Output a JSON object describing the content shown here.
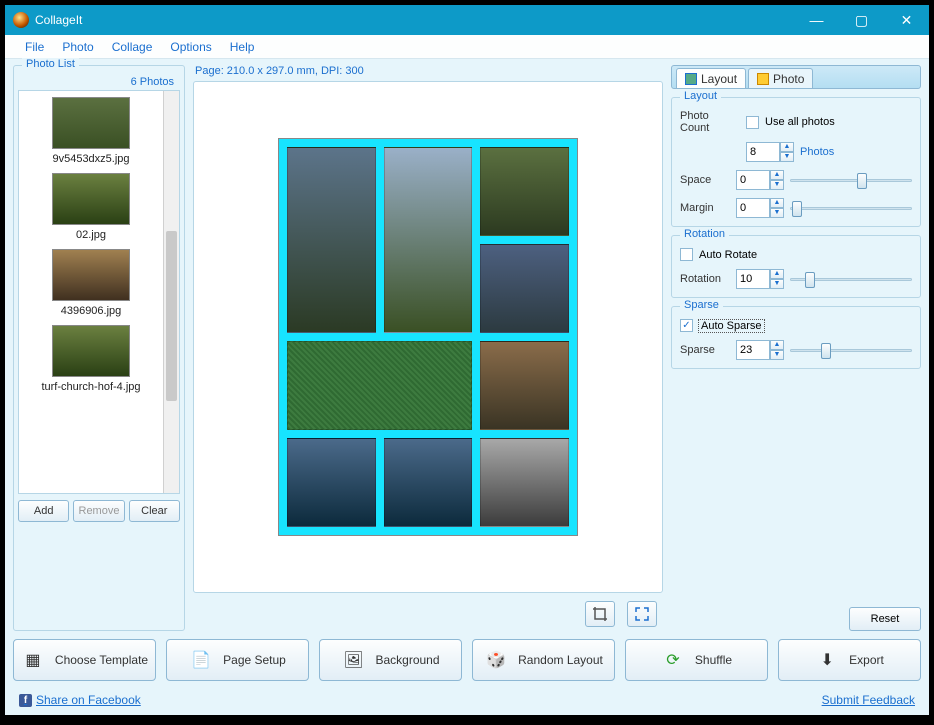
{
  "window": {
    "title": "CollageIt"
  },
  "menu": {
    "items": [
      "File",
      "Photo",
      "Collage",
      "Options",
      "Help"
    ]
  },
  "photoList": {
    "legend": "Photo List",
    "countLabel": "6 Photos",
    "items": [
      {
        "name": "9v5453dxz5.jpg"
      },
      {
        "name": "02.jpg"
      },
      {
        "name": "4396906.jpg"
      },
      {
        "name": "turf-church-hof-4.jpg"
      }
    ],
    "buttons": {
      "add": "Add",
      "remove": "Remove",
      "clear": "Clear"
    }
  },
  "page": {
    "info": "Page: 210.0 x 297.0 mm, DPI: 300"
  },
  "rightTabs": {
    "layout": "Layout",
    "photo": "Photo"
  },
  "layout": {
    "legend": "Layout",
    "photoCountLabel": "Photo Count",
    "useAllPhotos": "Use all photos",
    "photoCountValue": "8",
    "photosSuffix": "Photos",
    "spaceLabel": "Space",
    "spaceValue": "0",
    "marginLabel": "Margin",
    "marginValue": "0"
  },
  "rotation": {
    "legend": "Rotation",
    "autoRotate": "Auto Rotate",
    "rotationLabel": "Rotation",
    "rotationValue": "10"
  },
  "sparse": {
    "legend": "Sparse",
    "autoSparse": "Auto Sparse",
    "sparseLabel": "Sparse",
    "sparseValue": "23"
  },
  "reset": "Reset",
  "bottom": {
    "chooseTemplate": "Choose Template",
    "pageSetup": "Page Setup",
    "background": "Background",
    "randomLayout": "Random Layout",
    "shuffle": "Shuffle",
    "export": "Export"
  },
  "footer": {
    "facebook": "Share on Facebook",
    "feedback": "Submit Feedback"
  }
}
